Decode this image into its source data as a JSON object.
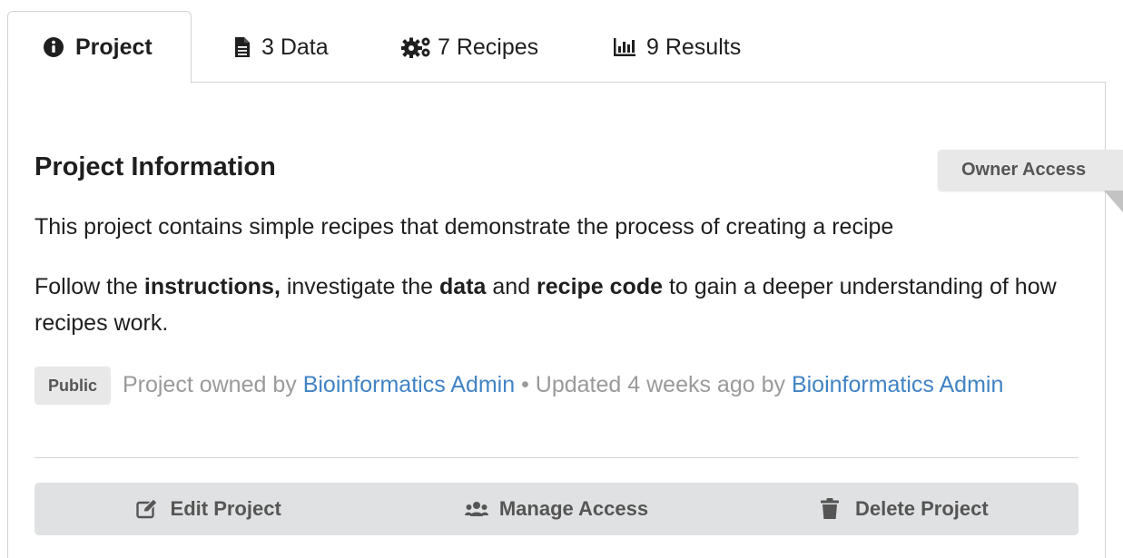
{
  "tabs": {
    "project": {
      "label": "Project",
      "icon": "info-circle-icon"
    },
    "data": {
      "label": "3 Data",
      "icon": "file-icon"
    },
    "recipes": {
      "label": "7 Recipes",
      "icon": "gears-icon"
    },
    "results": {
      "label": "9 Results",
      "icon": "bar-chart-icon"
    }
  },
  "ribbon": {
    "label": "Owner Access"
  },
  "project": {
    "title": "Project Information",
    "summary": "This project contains simple recipes that demonstrate the process of creating a recipe",
    "instructions": {
      "part1": "Follow the ",
      "bold1": "instructions,",
      "part2": " investigate the ",
      "bold2": "data",
      "part3": " and ",
      "bold3": "recipe code",
      "part4": " to gain a deeper understanding of how recipes work."
    }
  },
  "meta": {
    "badge": "Public",
    "owned_prefix": "Project owned by",
    "owner": "Bioinformatics Admin",
    "updated_text": "• Updated 4 weeks ago by",
    "updater": "Bioinformatics Admin"
  },
  "actions": {
    "edit": "Edit Project",
    "manage": "Manage Access",
    "delete": "Delete Project"
  },
  "colors": {
    "link": "#4183c4",
    "button_bg": "#e0e1e2",
    "ribbon_bg": "#e8e8e8"
  }
}
